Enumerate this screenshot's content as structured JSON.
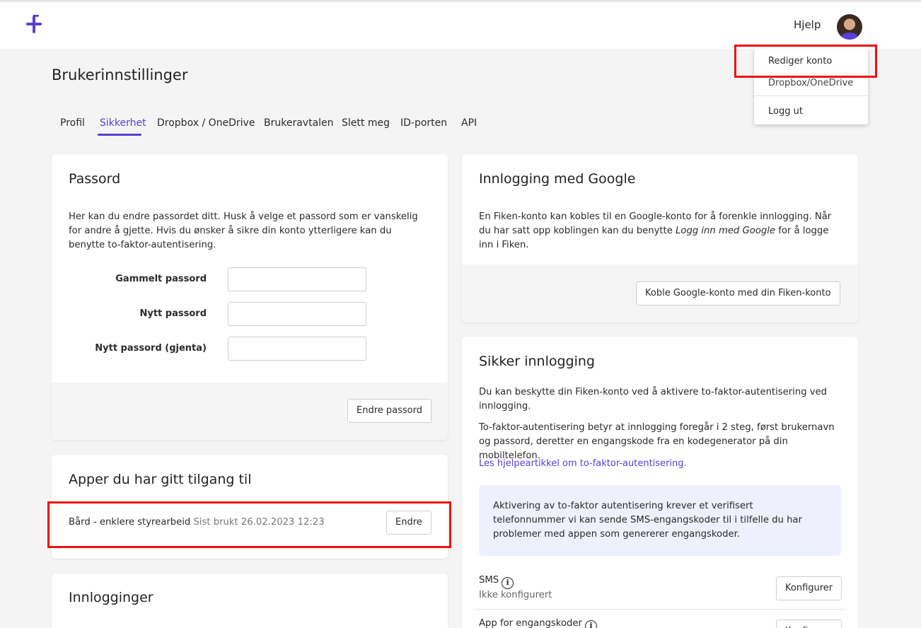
{
  "header": {
    "help_label": "Hjelp"
  },
  "account_menu": {
    "items": [
      "Rediger konto",
      "Dropbox/OneDrive",
      "Logg ut"
    ]
  },
  "page": {
    "title": "Brukerinnstillinger"
  },
  "tabs": [
    "Profil",
    "Sikkerhet",
    "Dropbox / OneDrive",
    "Brukeravtalen",
    "Slett meg",
    "ID-porten",
    "API"
  ],
  "active_tab": "Sikkerhet",
  "password_card": {
    "title": "Passord",
    "description": "Her kan du endre passordet ditt. Husk å velge et passord som er vanskelig for andre å gjette. Hvis du ønsker å sikre din konto ytterligere kan du benytte to-faktor-autentisering.",
    "fields": [
      {
        "label": "Gammelt passord",
        "value": ""
      },
      {
        "label": "Nytt passord",
        "value": ""
      },
      {
        "label": "Nytt passord (gjenta)",
        "value": ""
      }
    ],
    "submit_label": "Endre passord"
  },
  "apps_card": {
    "title": "Apper du har gitt tilgang til",
    "apps": [
      {
        "name": "Bård - enklere styrearbeid",
        "last_used": "Sist brukt 26.02.2023 12:23",
        "action_label": "Endre"
      }
    ]
  },
  "logins_card": {
    "title": "Innlogginger"
  },
  "google_card": {
    "title": "Innlogging med Google",
    "text_before": "En Fiken-konto kan kobles til en Google-konto for å forenkle innlogging. Når du har satt opp koblingen kan du benytte ",
    "text_emphasis": "Logg inn med Google",
    "text_after": " for å logge inn i Fiken.",
    "button_label": "Koble Google-konto med din Fiken-konto"
  },
  "secure_card": {
    "title": "Sikker innlogging",
    "paragraph1": "Du kan beskytte din Fiken-konto ved å aktivere to-faktor-autentisering ved innlogging.",
    "paragraph2": "To-faktor-autentisering betyr at innlogging foregår i 2 steg, først brukernavn og passord, deretter en engangskode fra en kodegenerator på din mobiltelefon.",
    "help_link": "Les hjelpeartikkel om to-faktor-autentisering.",
    "info_text": "Aktivering av to-faktor autentisering krever et verifisert telefonnummer vi kan sende SMS-engangskoder til i tilfelle du har problemer med appen som genererer engangskoder.",
    "options": [
      {
        "label": "SMS",
        "status": "Ikke konfigurert",
        "button_label": "Konfigurer"
      },
      {
        "label": "App for engangskoder",
        "status": "",
        "button_label": "Konfigurer"
      }
    ]
  },
  "colors": {
    "accent": "#5a3fd1",
    "highlight_box": "#e11111",
    "info_background": "#eef1fd"
  }
}
